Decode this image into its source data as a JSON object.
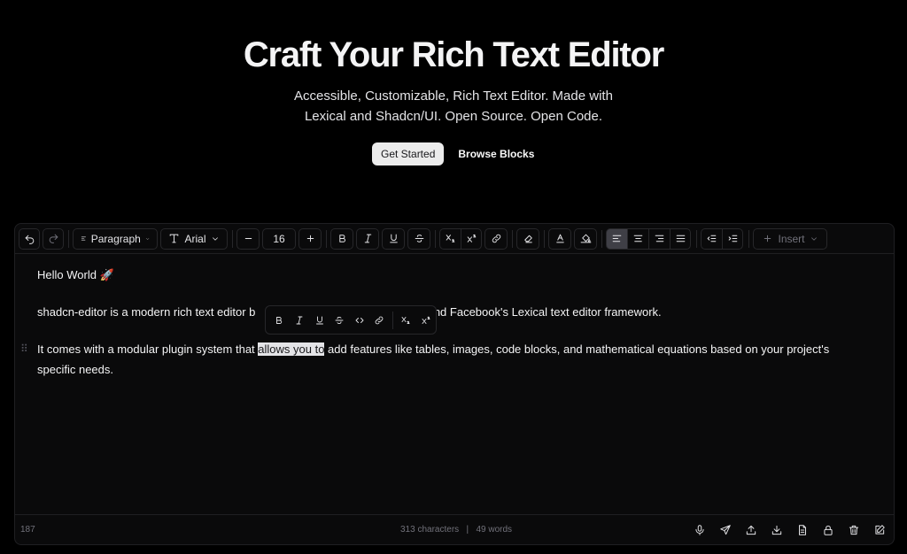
{
  "hero": {
    "title": "Craft Your Rich Text Editor",
    "subtitle_line1": "Accessible, Customizable, Rich Text Editor. Made with",
    "subtitle_line2": "Lexical and Shadcn/UI. Open Source. Open Code.",
    "primary_button": "Get Started",
    "secondary_button": "Browse Blocks"
  },
  "toolbar": {
    "block_type": "Paragraph",
    "font_family": "Arial",
    "font_size": "16",
    "insert_label": "Insert"
  },
  "content": {
    "heading": "Hello World 🚀",
    "para1_start": "shadcn-editor is a modern rich text editor b",
    "para1_end": "ents and Facebook's Lexical text editor framework.",
    "para2_before": "It comes with a modular plugin system that ",
    "para2_selected": "allows you to",
    "para2_after": " add features like tables, images, code blocks, and mathematical equations based on your project's",
    "para2_line2": "specific needs."
  },
  "footer": {
    "line_number": "187",
    "characters": "313 characters",
    "separator": "|",
    "words": "49 words"
  },
  "colors": {
    "background": "#000000",
    "panel": "#0a0a0b",
    "border": "#27272a",
    "selection": "#e4e4e7"
  }
}
